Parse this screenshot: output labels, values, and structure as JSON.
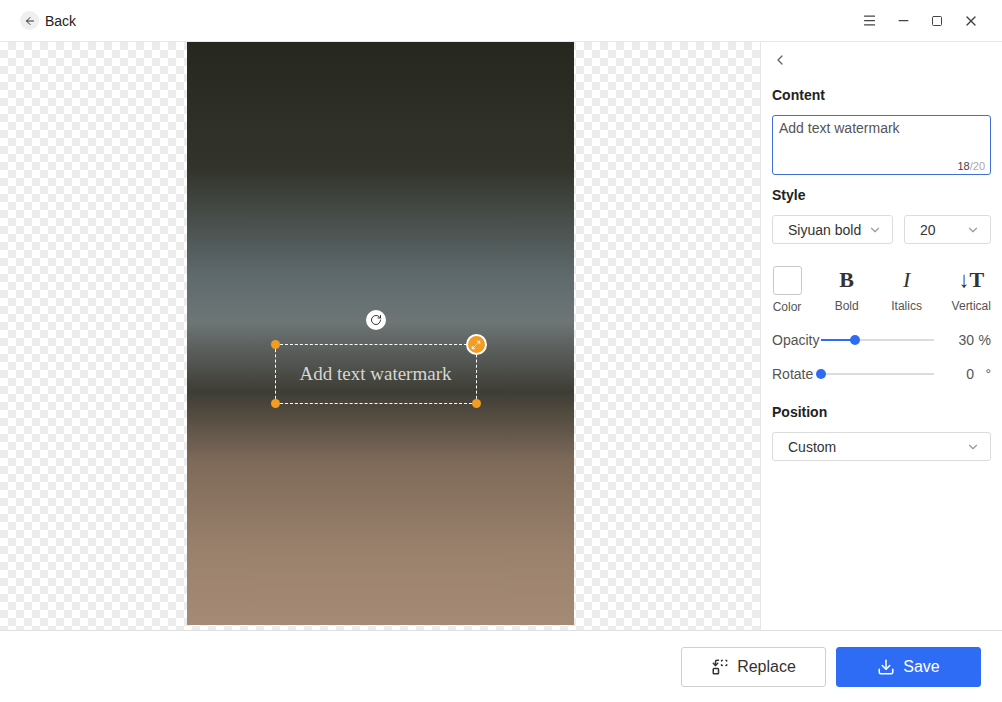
{
  "header": {
    "back": "Back"
  },
  "canvas": {
    "watermark": {
      "text": "Add text watermark",
      "selected": true
    }
  },
  "panel": {
    "content": {
      "label": "Content",
      "value": "Add text watermark",
      "count": "18",
      "max": "/20"
    },
    "style": {
      "label": "Style",
      "font": "Siyuan bold",
      "size": "20",
      "toggles": [
        {
          "label": "Color",
          "kind": "swatch",
          "glyph": "",
          "color": "#ffffff",
          "selected": false
        },
        {
          "label": "Bold",
          "kind": "bold",
          "glyph": "B",
          "color": "",
          "selected": false
        },
        {
          "label": "Italics",
          "kind": "italic",
          "glyph": "I",
          "color": "",
          "selected": false
        },
        {
          "label": "Vertical",
          "kind": "vertical",
          "glyph": "↓T",
          "color": "",
          "selected": false
        }
      ],
      "sliders": [
        {
          "label": "Opacity",
          "level": 0.3,
          "reading": "30",
          "unit": "%"
        },
        {
          "label": "Rotate",
          "level": 0,
          "reading": "0",
          "unit": "°"
        }
      ]
    },
    "position": {
      "label": "Position",
      "value": "Custom"
    }
  },
  "buttons": [
    {
      "label": "Replace",
      "kind": "secondary"
    },
    {
      "label": "Save",
      "kind": "primary"
    }
  ]
}
